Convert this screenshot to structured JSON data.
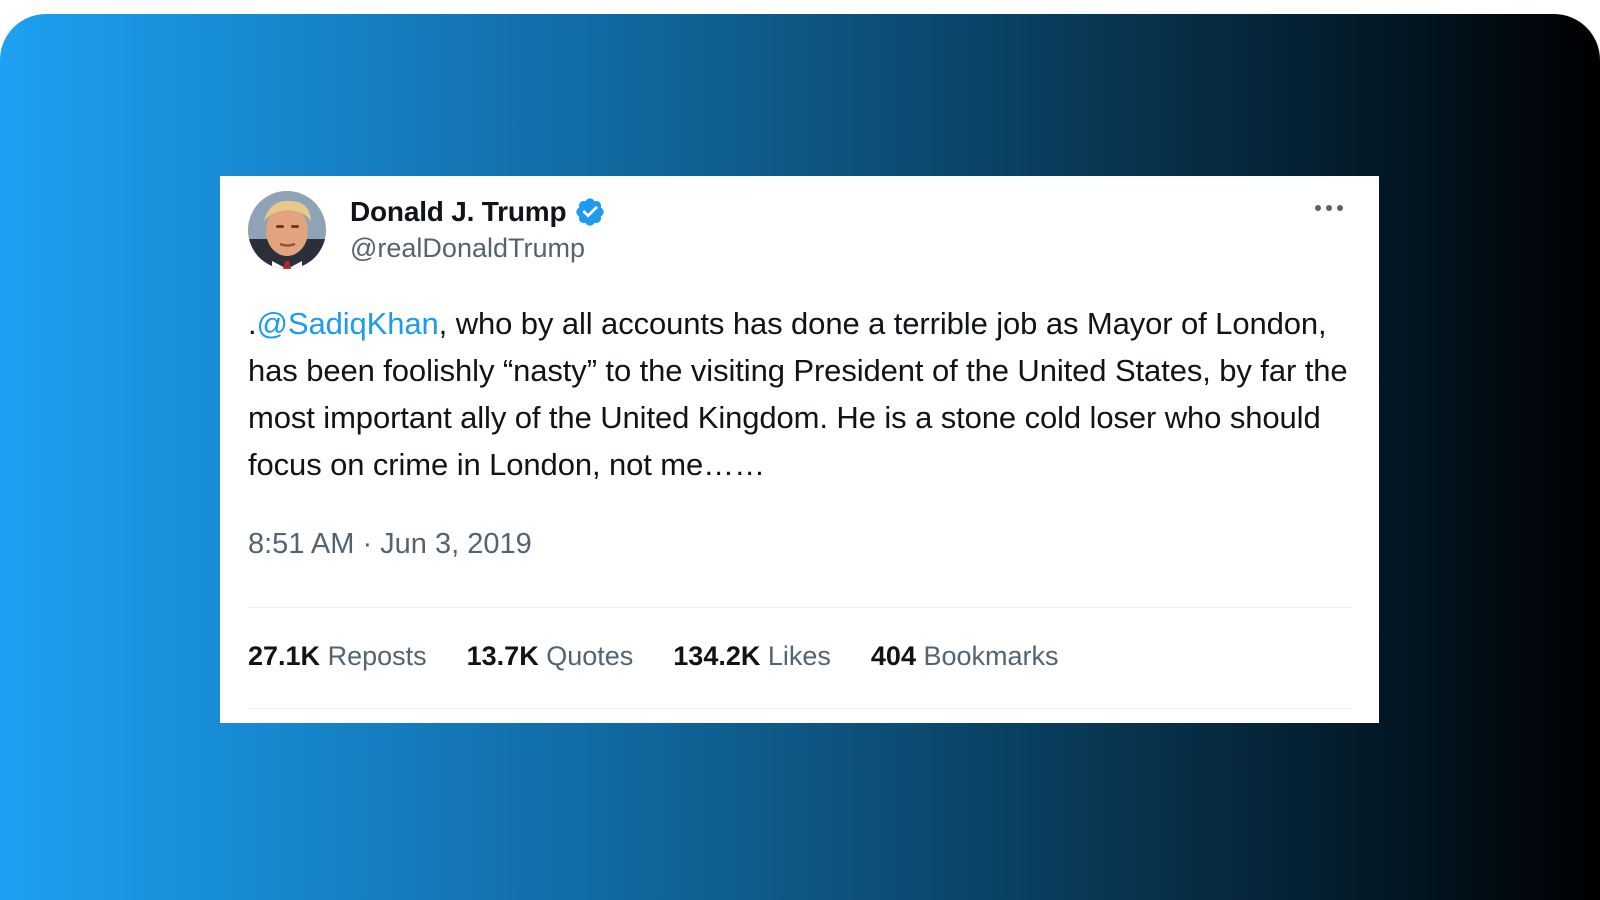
{
  "tweet": {
    "author": {
      "name": "Donald J. Trump",
      "handle": "@realDonaldTrump",
      "verified": true
    },
    "text": {
      "prefix": ".",
      "mention": "@SadiqKhan",
      "body": ", who by all accounts has done a terrible job as Mayor of London, has been foolishly “nasty” to the visiting President of the United States, by far the most important ally of the United Kingdom. He is a stone cold loser who should focus on crime in London, not me……"
    },
    "timestamp": "8:51 AM · Jun 3, 2019",
    "stats": [
      {
        "value": "27.1K",
        "label": "Reposts"
      },
      {
        "value": "13.7K",
        "label": "Quotes"
      },
      {
        "value": "134.2K",
        "label": "Likes"
      },
      {
        "value": "404",
        "label": "Bookmarks"
      }
    ]
  },
  "icons": {
    "verified": "verified-badge-icon",
    "more": "more-options-icon",
    "avatar": "profile-photo"
  },
  "colors": {
    "accent": "#1d9bf0",
    "text_primary": "#0f1419",
    "text_secondary": "#536471",
    "background_gradient_start": "#1da1f2",
    "background_gradient_end": "#000000"
  }
}
